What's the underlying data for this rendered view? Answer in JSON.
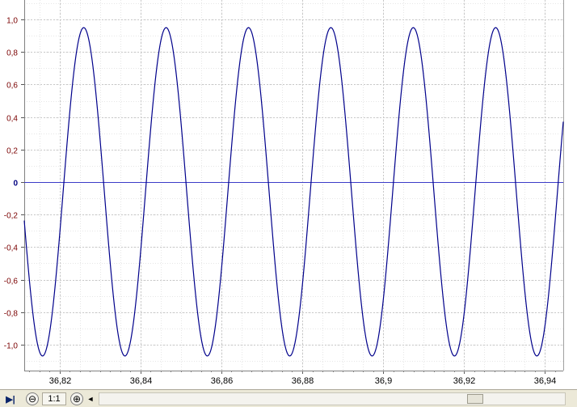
{
  "chart_data": {
    "type": "line",
    "title": "",
    "xlabel": "",
    "ylabel": "",
    "xlim": [
      36.8113,
      36.9445
    ],
    "ylim": [
      -1.16,
      1.12
    ],
    "grid": true,
    "legend": "none",
    "y_ticks": [
      {
        "value": 1.0,
        "label": "1,0"
      },
      {
        "value": 0.8,
        "label": "0,8"
      },
      {
        "value": 0.6,
        "label": "0,6"
      },
      {
        "value": 0.4,
        "label": "0,4"
      },
      {
        "value": 0.2,
        "label": "0,2"
      },
      {
        "value": 0.0,
        "label": "0"
      },
      {
        "value": -0.2,
        "label": "-0,2"
      },
      {
        "value": -0.4,
        "label": "-0,4"
      },
      {
        "value": -0.6,
        "label": "-0,6"
      },
      {
        "value": -0.8,
        "label": "-0,8"
      },
      {
        "value": -1.0,
        "label": "-1,0"
      }
    ],
    "x_ticks": [
      {
        "value": 36.82,
        "label": "36,82"
      },
      {
        "value": 36.84,
        "label": "36,84"
      },
      {
        "value": 36.86,
        "label": "36,86"
      },
      {
        "value": 36.88,
        "label": "36,88"
      },
      {
        "value": 36.9,
        "label": "36,9"
      },
      {
        "value": 36.92,
        "label": "36,92"
      },
      {
        "value": 36.94,
        "label": "36,94"
      }
    ],
    "series": [
      {
        "color": "#00008b",
        "waveform": {
          "shape": "sine",
          "amplitude": 1.01,
          "offset": -0.06,
          "period": 0.02036,
          "peak_x": 36.826
        }
      }
    ],
    "reference_line": {
      "y": 0,
      "color": "#3c3cc8"
    }
  },
  "toolbar": {
    "play_icon": "play-to-end-icon",
    "zoom_out_icon": "zoom-out-icon",
    "zoom_out_glyph": "⊖",
    "zoom_label": "1:1",
    "zoom_in_icon": "zoom-in-icon",
    "zoom_in_glyph": "⊕",
    "scroll_left_icon": "arrow-left-icon",
    "scroll_left_glyph": "◄",
    "play_glyph": "▶|"
  },
  "colors": {
    "grid_major": "#c8c8c8",
    "grid_minor": "#e6e6e6",
    "axis_labels": "#7a0000",
    "toolbar_bg": "#ece9d8"
  }
}
